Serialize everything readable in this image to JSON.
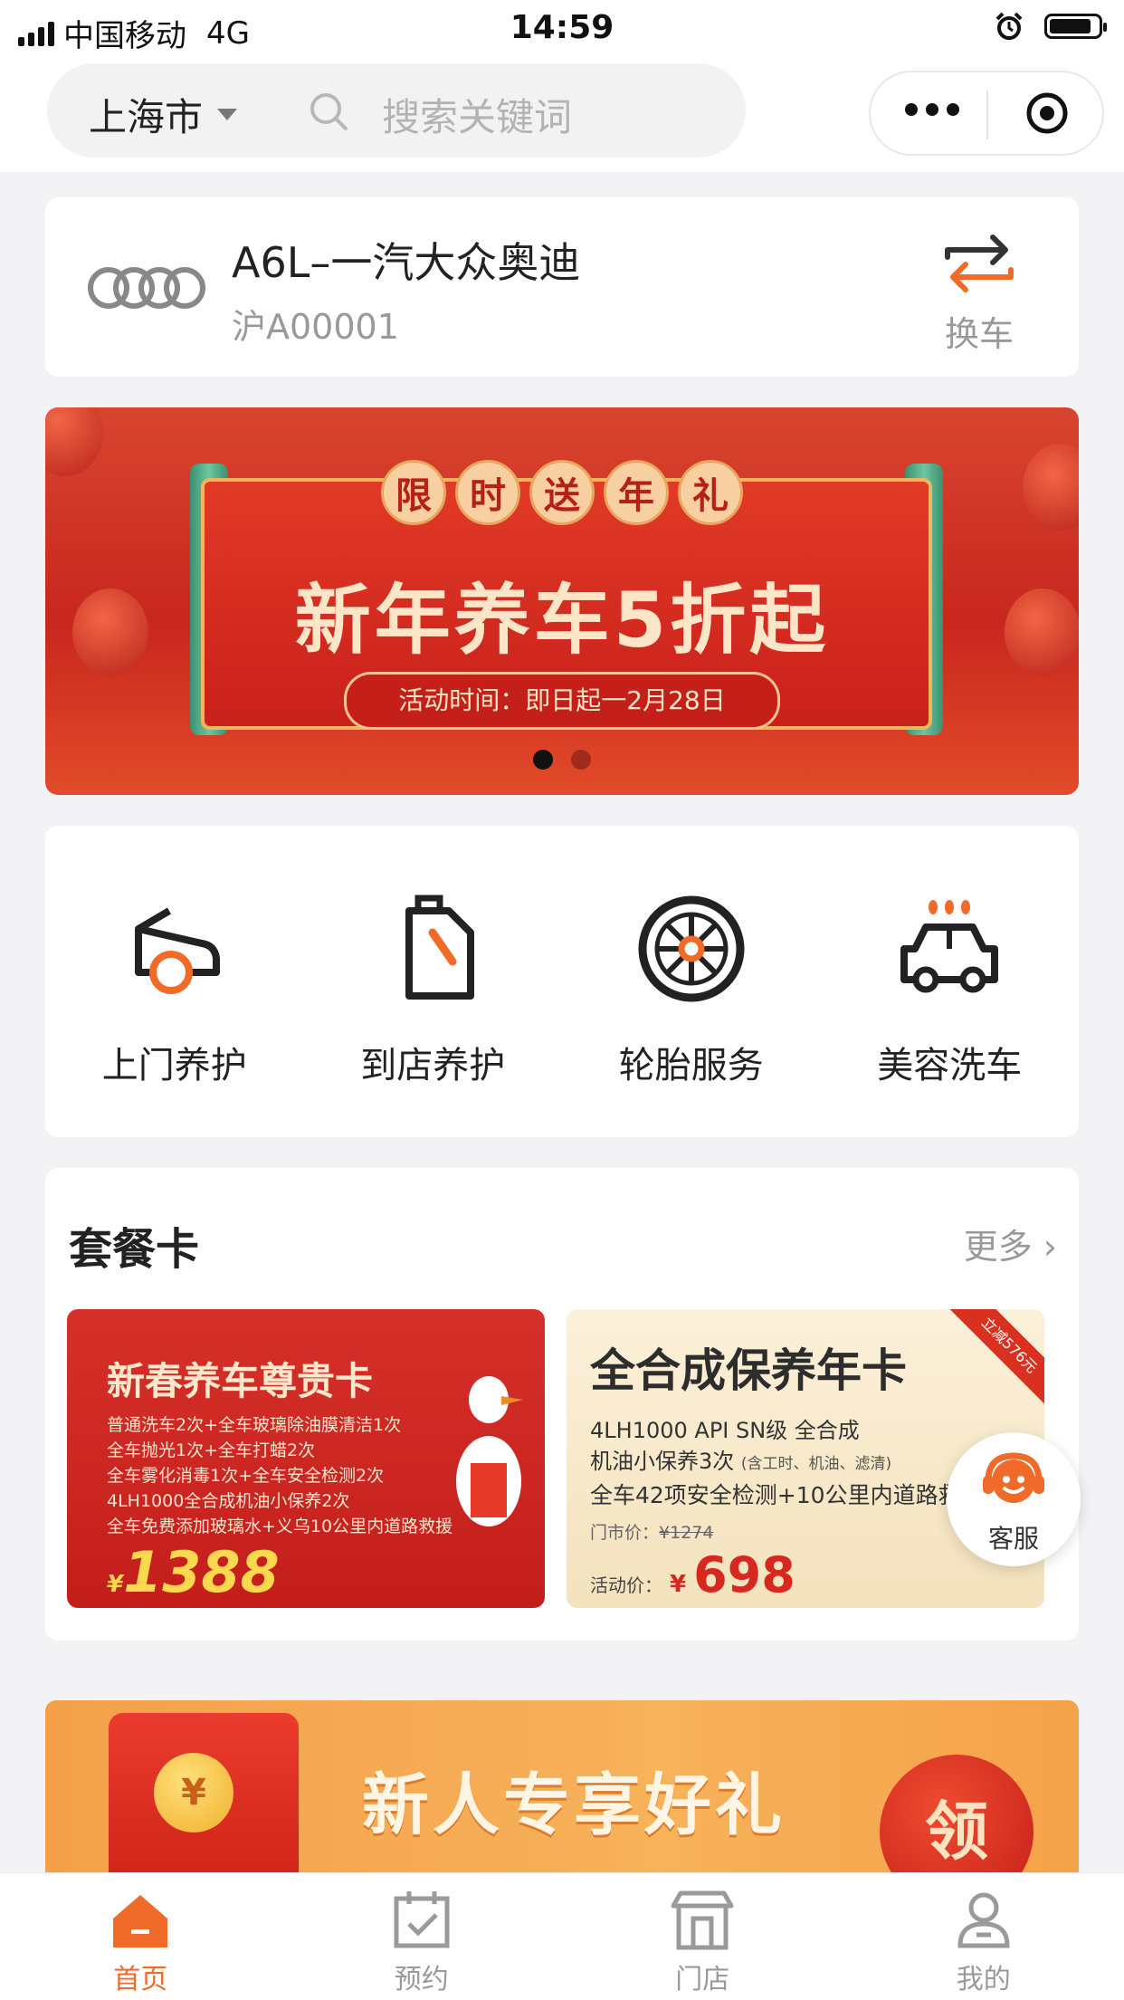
{
  "status_bar": {
    "carrier": "中国移动",
    "network": "4G",
    "time": "14:59"
  },
  "header": {
    "city": "上海市",
    "search_placeholder": "搜索关键词"
  },
  "car": {
    "name": "A6L–一汽大众奥迪",
    "plate": "沪A00001",
    "switch_label": "换车",
    "brand_icon": "audi-rings-icon"
  },
  "banner": {
    "badges": [
      "限",
      "时",
      "送",
      "年",
      "礼"
    ],
    "title": "新年养车5折起",
    "subtitle": "活动时间：即日起一2月28日",
    "page_count": 2,
    "active_page": 1
  },
  "services": [
    {
      "label": "上门养护",
      "icon": "car-hood-icon"
    },
    {
      "label": "到店养护",
      "icon": "oil-bottle-icon"
    },
    {
      "label": "轮胎服务",
      "icon": "tire-icon"
    },
    {
      "label": "美容洗车",
      "icon": "car-wash-icon"
    }
  ],
  "package_section": {
    "title": "套餐卡",
    "more": "更多 ›",
    "card1": {
      "title": "新春养车尊贵卡",
      "lines": [
        "普通洗车2次+全车玻璃除油膜清洁1次",
        "全车抛光1次+全车打蜡2次",
        "全车雾化消毒1次+全车安全检测2次",
        "4LH1000全合成机油小保养2次",
        "全车免费添加玻璃水+义乌10公里内道路救援"
      ],
      "currency": "¥",
      "price": "1388"
    },
    "card2": {
      "title": "全合成保养年卡",
      "line1": "4LH1000 API SN级 全合成",
      "line2": "机油小保养3次",
      "line2_note": "(含工时、机油、滤清)",
      "line3": "全车42项安全检测+10公里内道路救援",
      "original_label": "门市价：",
      "original_price": "¥1274",
      "activity_label": "活动价：",
      "currency": "¥",
      "activity_price": "698",
      "ribbon": "立减576元"
    }
  },
  "customer_service": {
    "label": "客服"
  },
  "new_user_banner": {
    "title": "新人专享好礼",
    "button": "领",
    "coin": "¥"
  },
  "tabbar": [
    {
      "label": "首页",
      "icon": "home-icon",
      "active": true
    },
    {
      "label": "预约",
      "icon": "calendar-check-icon",
      "active": false
    },
    {
      "label": "门店",
      "icon": "store-icon",
      "active": false
    },
    {
      "label": "我的",
      "icon": "user-icon",
      "active": false
    }
  ],
  "colors": {
    "accent": "#f06a2a",
    "tab_inactive": "#9a9a9a",
    "price_red": "#d7281f"
  }
}
